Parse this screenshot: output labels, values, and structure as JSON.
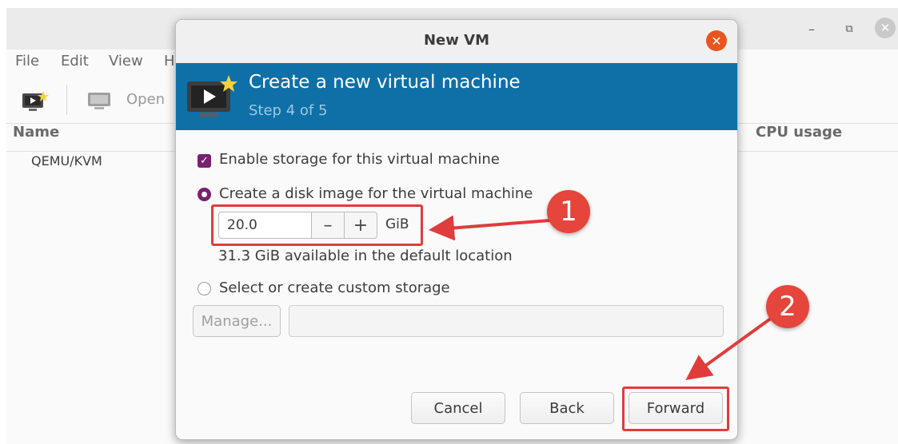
{
  "main_window": {
    "window_controls": {
      "minimize": "–",
      "restore": "⧉",
      "close": "✕"
    },
    "menu": [
      "File",
      "Edit",
      "View",
      "H"
    ],
    "toolbar": {
      "open_label": "Open"
    },
    "columns": {
      "name": "Name",
      "cpu": "CPU usage"
    },
    "connections": [
      "QEMU/KVM"
    ]
  },
  "dialog": {
    "title": "New VM",
    "close_glyph": "✕",
    "header": {
      "title": "Create a new virtual machine",
      "step": "Step 4 of 5"
    },
    "storage": {
      "enable_label": "Enable storage for this virtual machine",
      "enable_checked": true,
      "create_disk_label": "Create a disk image for the virtual machine",
      "create_disk_selected": true,
      "disk_size": "20.0",
      "decrement": "–",
      "increment": "+",
      "unit": "GiB",
      "available_text": "31.3 GiB available in the default location",
      "custom_label": "Select or create custom storage",
      "custom_selected": false,
      "manage_label": "Manage...",
      "custom_path": ""
    },
    "buttons": {
      "cancel": "Cancel",
      "back": "Back",
      "forward": "Forward"
    }
  },
  "annotations": [
    {
      "number": "1"
    },
    {
      "number": "2"
    }
  ],
  "colors": {
    "banner": "#0f70a8",
    "accent_purple": "#77216f",
    "close_orange": "#e95420",
    "annotation_red": "#e03c3c"
  }
}
